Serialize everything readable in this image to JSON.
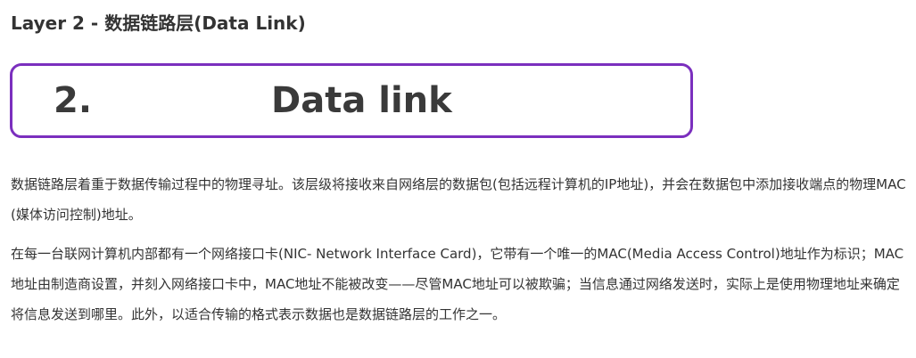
{
  "heading": "Layer 2 - 数据链路层(Data Link)",
  "banner": {
    "number": "2.",
    "title": "Data link",
    "border_color": "#7b2fbe"
  },
  "paragraphs": [
    "数据链路层着重于数据传输过程中的物理寻址。该层级将接收来自网络层的数据包(包括远程计算机的IP地址)，并会在数据包中添加接收端点的物理MAC(媒体访问控制)地址。",
    "在每一台联网计算机内部都有一个网络接口卡(NIC- Network Interface Card)，它带有一个唯一的MAC(Media Access Control)地址作为标识；MAC地址由制造商设置，并刻入网络接口卡中，MAC地址不能被改变——尽管MAC地址可以被欺骗；当信息通过网络发送时，实际上是使用物理地址来确定将信息发送到哪里。此外，以适合传输的格式表示数据也是数据链路层的工作之一。"
  ]
}
